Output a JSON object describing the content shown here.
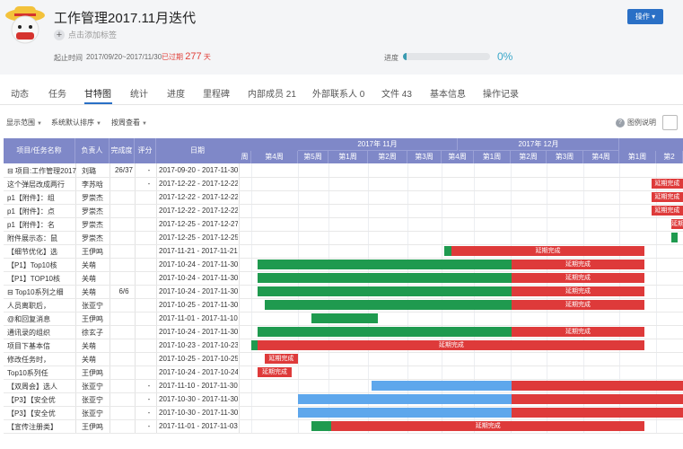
{
  "header": {
    "title": "工作管理2017.11月迭代",
    "add_tag": "点击添加标签",
    "time_label": "起止时间",
    "time_value": "2017/09/20~2017/11/30",
    "overdue_prefix": "已过期",
    "overdue_days": "277",
    "overdue_suffix": "天",
    "progress_label": "进度",
    "progress_value": 0.0,
    "progress_text": "0%",
    "op_button": "操作 ▾"
  },
  "tabs": [
    "动态",
    "任务",
    "甘特图",
    "统计",
    "进度",
    "里程碑",
    "内部成员 21",
    "外部联系人 0",
    "文件 43",
    "基本信息",
    "操作记录"
  ],
  "active_tab": "甘特图",
  "filters": {
    "scope": "显示范围",
    "sort": "系统默认排序",
    "view": "按周查看",
    "legend": "图例说明"
  },
  "columns": {
    "name": "项目/任务名称",
    "owner": "负责人",
    "done": "完成度",
    "score": "评分",
    "date": "日期"
  },
  "timeline": {
    "months": [
      "2017年 11月",
      "2017年 12月"
    ],
    "weeks": [
      "周",
      "第4周",
      "第5周",
      "第1周",
      "第2周",
      "第3周",
      "第4周",
      "第1周",
      "第2周",
      "第3周",
      "第4周",
      "第1周",
      "第2"
    ]
  },
  "rows": [
    {
      "name": "⊟ 项目:工作管理2017",
      "owner": "刘璐",
      "done": "26/37",
      "score": "-",
      "date": "2017-09-20 - 2017-11-30"
    },
    {
      "name": "这个弹层改成两行",
      "owner": "李苏晗",
      "done": "",
      "score": "-",
      "date": "2017-12-22 - 2017-12-22"
    },
    {
      "name": "p1【附件】：组",
      "owner": "罗崇杰",
      "done": "",
      "score": "",
      "date": "2017-12-22 - 2017-12-22"
    },
    {
      "name": "p1【附件】：点",
      "owner": "罗崇杰",
      "done": "",
      "score": "",
      "date": "2017-12-22 - 2017-12-22"
    },
    {
      "name": "p1【附件】：名",
      "owner": "罗崇杰",
      "done": "",
      "score": "",
      "date": "2017-12-25 - 2017-12-27"
    },
    {
      "name": "附件展示态：鼠",
      "owner": "罗崇杰",
      "done": "",
      "score": "",
      "date": "2017-12-25 - 2017-12-25"
    },
    {
      "name": "【细节优化】选",
      "owner": "王伊鸣",
      "done": "",
      "score": "",
      "date": "2017-11-21 - 2017-11-21"
    },
    {
      "name": "【P1】Top10核",
      "owner": "关萌",
      "done": "",
      "score": "",
      "date": "2017-10-24 - 2017-11-30"
    },
    {
      "name": "【P1】TOP10核",
      "owner": "关萌",
      "done": "",
      "score": "",
      "date": "2017-10-24 - 2017-11-30"
    },
    {
      "name": "⊟ Top10系列之细",
      "owner": "关萌",
      "done": "6/6",
      "score": "",
      "date": "2017-10-24 - 2017-11-30"
    },
    {
      "name": "人员离职后，",
      "owner": "张亚宁",
      "done": "",
      "score": "",
      "date": "2017-10-25 - 2017-11-30"
    },
    {
      "name": "@和回复消息",
      "owner": "王伊鸣",
      "done": "",
      "score": "",
      "date": "2017-11-01 - 2017-11-10"
    },
    {
      "name": "通讯录的组织",
      "owner": "徐玄子",
      "done": "",
      "score": "",
      "date": "2017-10-24 - 2017-11-30"
    },
    {
      "name": "项目下基本信",
      "owner": "关萌",
      "done": "",
      "score": "",
      "date": "2017-10-23 - 2017-10-23"
    },
    {
      "name": "修改任务时，",
      "owner": "关萌",
      "done": "",
      "score": "",
      "date": "2017-10-25 - 2017-10-25"
    },
    {
      "name": "Top10系列任",
      "owner": "王伊鸣",
      "done": "",
      "score": "",
      "date": "2017-10-24 - 2017-10-24"
    },
    {
      "name": "【双周会】选人",
      "owner": "张亚宁",
      "done": "",
      "score": "-",
      "date": "2017-11-10 - 2017-11-30"
    },
    {
      "name": "【P3】【安全优",
      "owner": "张亚宁",
      "done": "",
      "score": "-",
      "date": "2017-10-30 - 2017-11-30"
    },
    {
      "name": "【P3】【安全优",
      "owner": "张亚宁",
      "done": "",
      "score": "-",
      "date": "2017-10-30 - 2017-11-30"
    },
    {
      "name": "【宣传注册类】",
      "owner": "王伊鸣",
      "done": "",
      "score": "-",
      "date": "2017-11-01 - 2017-11-03"
    }
  ],
  "bar_label": "延期完成",
  "colors": {
    "on_time": "#1f9a4f",
    "delayed": "#de3a3a",
    "pending": "#5ea7ec",
    "accent": "#2a70c6",
    "header": "#7f88c8"
  }
}
